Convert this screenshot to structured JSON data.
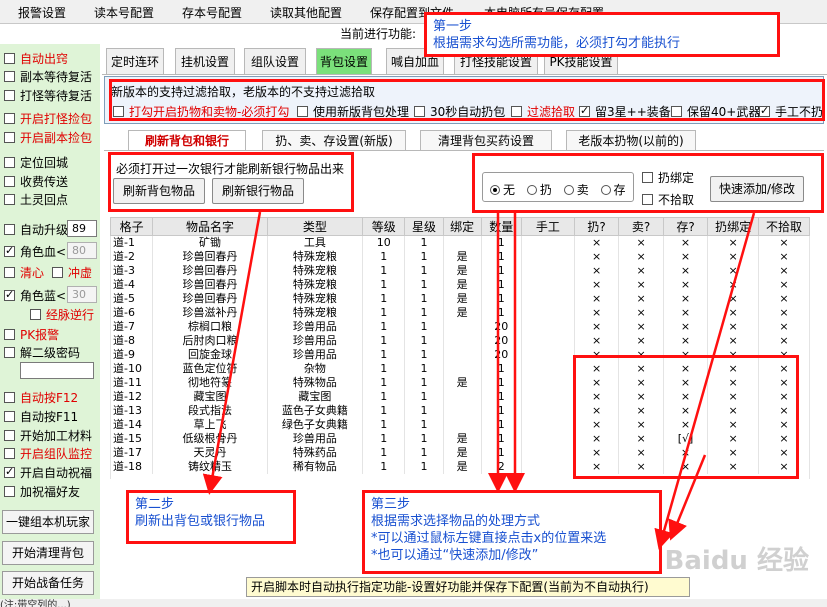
{
  "menu": [
    "报警设置",
    "读本号配置",
    "存本号配置",
    "读取其他配置",
    "保存配置到文件",
    "本电脑所有号保存配置"
  ],
  "status_label": "当前进行功能:",
  "left_panel": {
    "items": [
      {
        "label": "自动出窍",
        "checked": false,
        "red": true
      },
      {
        "label": "副本等待复活",
        "checked": false,
        "red": false
      },
      {
        "label": "打怪等待复活",
        "checked": false,
        "red": false
      },
      {
        "label": "开启打怪捡包",
        "checked": false,
        "red": true
      },
      {
        "label": "开启副本捡包",
        "checked": false,
        "red": true
      },
      {
        "label": "定位回城",
        "checked": false,
        "red": false
      },
      {
        "label": "收费传送",
        "checked": false,
        "red": false
      },
      {
        "label": "土灵回点",
        "checked": false,
        "red": false
      }
    ],
    "auto_upgrade_label": "自动升级",
    "auto_upgrade_value": "89",
    "hp_label": "角色血<",
    "hp_value": "80",
    "clear_heart": "清心",
    "chong_xu": "冲虚",
    "mp_label": "角色蓝<",
    "mp_value": "30",
    "meridian": "经脉逆行",
    "pk_alarm": "PK报警",
    "second_pwd": "解二级密码",
    "items2": [
      {
        "label": "自动按F12",
        "checked": false,
        "red": true
      },
      {
        "label": "自动按F11",
        "checked": false,
        "red": false
      },
      {
        "label": "开始加工材料",
        "checked": false,
        "red": false
      },
      {
        "label": "开启组队监控",
        "checked": false,
        "red": true
      },
      {
        "label": "开启自动祝福",
        "checked": true,
        "red": false
      },
      {
        "label": "加祝福好友",
        "checked": false,
        "red": false
      }
    ],
    "buttons": [
      "一键组本机玩家",
      "开始清理背包",
      "开始战备任务"
    ]
  },
  "tabs": [
    "定时连环",
    "挂机设置",
    "组队设置",
    "背包设置",
    "喊自加血",
    "打怪技能设置",
    "PK技能设置"
  ],
  "active_tab": "背包设置",
  "filter": {
    "title": "新版本的支持过滤拾取，老版本的不支持过滤拾取",
    "options": [
      {
        "label": "打勾开启扔物和卖物-必须打勾",
        "checked": false,
        "red": true
      },
      {
        "label": "使用新版背包处理",
        "checked": false,
        "red": false
      },
      {
        "label": "30秒自动扔包",
        "checked": false,
        "red": false
      },
      {
        "label": "过滤拾取",
        "checked": false,
        "red": true
      },
      {
        "label": "留3星++装备",
        "checked": true,
        "red": false
      },
      {
        "label": "保留40+武器",
        "checked": false,
        "red": false
      },
      {
        "label": "手工不扔",
        "checked": true,
        "red": false
      }
    ]
  },
  "subtabs": [
    "刷新背包和银行",
    "扔、卖、存设置(新版)",
    "清理背包买药设置",
    "老版本扔物(以前的)"
  ],
  "refresh": {
    "note": "必须打开过一次银行才能刷新银行物品出来",
    "bag_button": "刷新背包物品",
    "bank_button": "刷新银行物品"
  },
  "action": {
    "radios": [
      "无",
      "扔",
      "卖",
      "存"
    ],
    "selected": "无",
    "bind_label": "扔绑定",
    "nopick_label": "不拾取",
    "quick_button": "快速添加/修改"
  },
  "table": {
    "headers": [
      "格子",
      "物品名字",
      "类型",
      "等级",
      "星级",
      "绑定",
      "数量",
      "手工",
      "扔?",
      "卖?",
      "存?",
      "扔绑定",
      "不拾取"
    ],
    "rows": [
      [
        "道-1",
        "矿锄",
        "工具",
        "10",
        "1",
        "",
        "1",
        "",
        "×",
        "×",
        "×",
        "×",
        "×"
      ],
      [
        "道-2",
        "珍兽回春丹",
        "特殊宠粮",
        "1",
        "1",
        "是",
        "1",
        "",
        "×",
        "×",
        "×",
        "×",
        "×"
      ],
      [
        "道-3",
        "珍兽回春丹",
        "特殊宠粮",
        "1",
        "1",
        "是",
        "1",
        "",
        "×",
        "×",
        "×",
        "×",
        "×"
      ],
      [
        "道-4",
        "珍兽回春丹",
        "特殊宠粮",
        "1",
        "1",
        "是",
        "1",
        "",
        "×",
        "×",
        "×",
        "×",
        "×"
      ],
      [
        "道-5",
        "珍兽回春丹",
        "特殊宠粮",
        "1",
        "1",
        "是",
        "1",
        "",
        "×",
        "×",
        "×",
        "×",
        "×"
      ],
      [
        "道-6",
        "珍兽滋补丹",
        "特殊宠粮",
        "1",
        "1",
        "是",
        "1",
        "",
        "×",
        "×",
        "×",
        "×",
        "×"
      ],
      [
        "道-7",
        "棕榈口粮",
        "珍兽用品",
        "1",
        "1",
        "",
        "20",
        "",
        "×",
        "×",
        "×",
        "×",
        "×"
      ],
      [
        "道-8",
        "后肘肉口粮",
        "珍兽用品",
        "1",
        "1",
        "",
        "20",
        "",
        "×",
        "×",
        "×",
        "×",
        "×"
      ],
      [
        "道-9",
        "回旋金球",
        "珍兽用品",
        "1",
        "1",
        "",
        "20",
        "",
        "×",
        "×",
        "×",
        "×",
        "×"
      ],
      [
        "道-10",
        "蓝色定位符",
        "杂物",
        "1",
        "1",
        "",
        "1",
        "",
        "×",
        "×",
        "×",
        "×",
        "×"
      ],
      [
        "道-11",
        "彻地符篆",
        "特殊物品",
        "1",
        "1",
        "是",
        "1",
        "",
        "×",
        "×",
        "×",
        "×",
        "×"
      ],
      [
        "道-12",
        "藏宝图",
        "藏宝图",
        "1",
        "1",
        "",
        "1",
        "",
        "×",
        "×",
        "×",
        "×",
        "×"
      ],
      [
        "道-13",
        "段式指法",
        "蓝色子女典籍",
        "1",
        "1",
        "",
        "1",
        "",
        "×",
        "×",
        "×",
        "×",
        "×"
      ],
      [
        "道-14",
        "草上飞",
        "绿色子女典籍",
        "1",
        "1",
        "",
        "1",
        "",
        "×",
        "×",
        "×",
        "×",
        "×"
      ],
      [
        "道-15",
        "低级根骨丹",
        "珍兽用品",
        "1",
        "1",
        "是",
        "1",
        "",
        "×",
        "×",
        "[√]",
        "×",
        "×"
      ],
      [
        "道-17",
        "天灵丹",
        "特殊药品",
        "1",
        "1",
        "是",
        "1",
        "",
        "×",
        "×",
        "×",
        "×",
        "×"
      ],
      [
        "道-18",
        "铸纹精玉",
        "稀有物品",
        "1",
        "1",
        "是",
        "2",
        "",
        "×",
        "×",
        "×",
        "×",
        "×"
      ]
    ]
  },
  "notes": {
    "step1": [
      "第一步",
      "根据需求勾选所需功能，必须打勾才能执行"
    ],
    "step2": [
      "第二步",
      "刷新出背包或银行物品"
    ],
    "step3": [
      "第三步",
      "根据需求选择物品的处理方式",
      "*可以通过鼠标左键直接点击x的位置来选",
      "*也可以通过“快速添加/修改”"
    ]
  },
  "bottom_bar": "开启脚本时自动执行指定功能-设置好功能并保存下配置(当前为不自动执行)",
  "footer": "(注:带空列的...)",
  "watermark": "Baidu 经验",
  "colors": {
    "accent_green": "#7be07b",
    "left_bg": "#dff4d7",
    "annotation_red": "#ff1010",
    "note_blue": "#1850d0"
  }
}
